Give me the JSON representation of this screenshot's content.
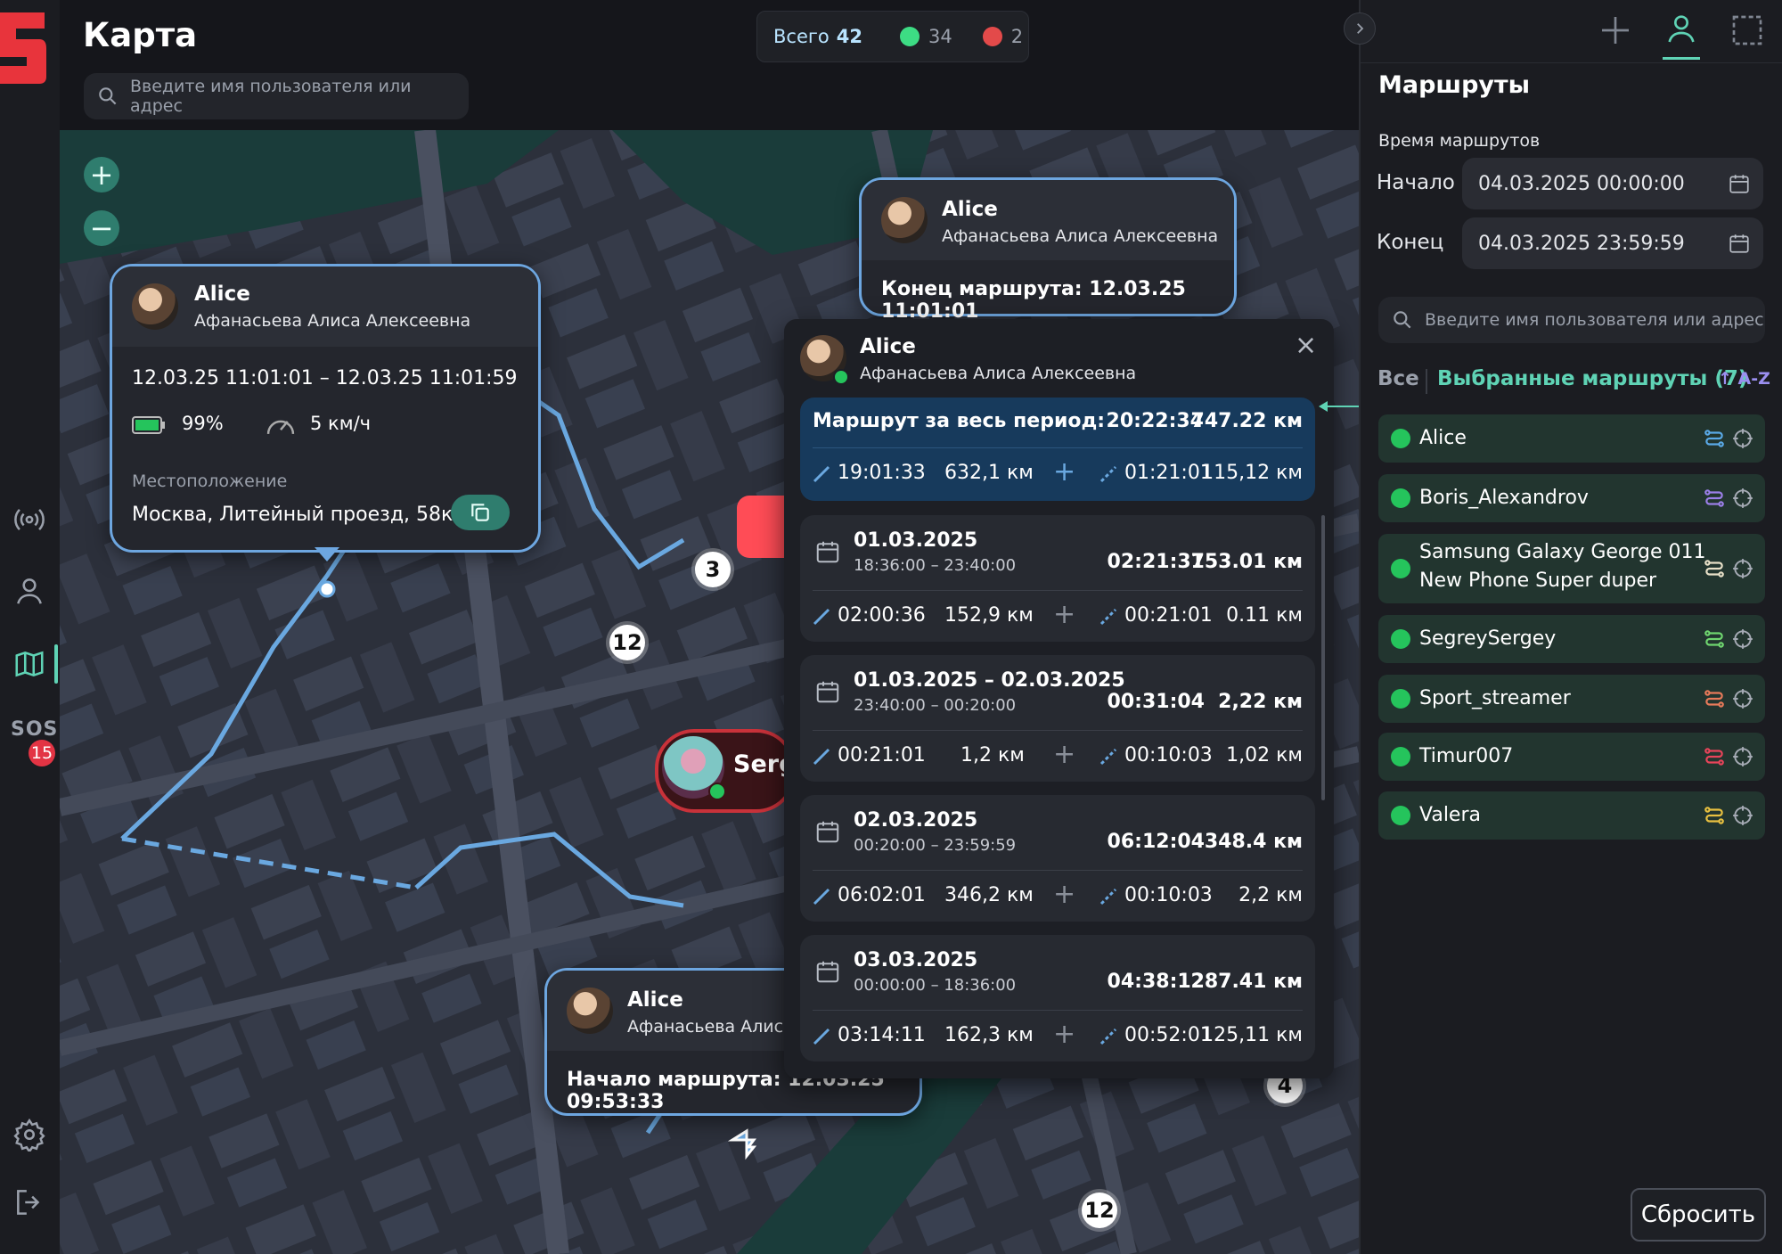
{
  "header": {
    "title": "Карта",
    "search_placeholder": "Введите имя пользователя или адрес",
    "counter": {
      "total_label": "Всего",
      "total": "42",
      "online": "34",
      "offline": "2"
    }
  },
  "sidebar": {
    "sos_label": "SOS",
    "sos_count": "15"
  },
  "map": {
    "clusters": [
      "3",
      "12",
      "4",
      "12"
    ],
    "marker_name": "Serg",
    "card_main": {
      "name": "Alice",
      "full_name": "Афанасьева Алиса Алексеевна",
      "range": "12.03.25  11:01:01 – 12.03.25  11:01:59",
      "battery": "99%",
      "speed": "5 км/ч",
      "location_label": "Местоположение",
      "address": "Москва, Литейный проезд, 58к2"
    },
    "card_end": {
      "name": "Alice",
      "full_name": "Афанасьева Алиса Алексеевна",
      "text": "Конец маршрута: 12.03.25  11:01:01"
    },
    "card_start": {
      "name": "Alice",
      "full_name": "Афанасьева Алиса",
      "text": "Начало маршрута: 12.03.25  09:53:33"
    }
  },
  "popup": {
    "name": "Alice",
    "full_name": "Афанасьева Алиса Алексеевна",
    "total": {
      "label": "Маршрут за весь период:",
      "duration": "20:22:34",
      "distance": "747.22 км",
      "move_time": "19:01:33",
      "move_dist": "632,1 км",
      "gap_time": "01:21:01",
      "gap_dist": "115,12 км"
    },
    "segments": [
      {
        "date": "01.03.2025",
        "time": "18:36:00 – 23:40:00",
        "duration": "02:21:37",
        "distance": "153.01 км",
        "move_time": "02:00:36",
        "move_dist": "152,9 км",
        "gap_time": "00:21:01",
        "gap_dist": "0.11 км"
      },
      {
        "date": "01.03.2025 – 02.03.2025",
        "time": "23:40:00 – 00:20:00",
        "duration": "00:31:04",
        "distance": "2,22 км",
        "move_time": "00:21:01",
        "move_dist": "1,2 км",
        "gap_time": "00:10:03",
        "gap_dist": "1,02 км"
      },
      {
        "date": "02.03.2025",
        "time": "00:20:00 – 23:59:59",
        "duration": "06:12:04",
        "distance": "348.4 км",
        "move_time": "06:02:01",
        "move_dist": "346,2 км",
        "gap_time": "00:10:03",
        "gap_dist": "2,2 км"
      },
      {
        "date": "03.03.2025",
        "time": "00:00:00 – 18:36:00",
        "duration": "04:38:12",
        "distance": "287.41 км",
        "move_time": "03:14:11",
        "move_dist": "162,3 км",
        "gap_time": "00:52:01",
        "gap_dist": "125,11 км"
      }
    ]
  },
  "routes_panel": {
    "title": "Маршруты",
    "time_label": "Время маршрутов",
    "start_label": "Начало",
    "start_value": "04.03.2025  00:00:00",
    "end_label": "Конец",
    "end_value": "04.03.2025  23:59:59",
    "search_placeholder": "Введите имя пользователя или адрес",
    "filter_all": "Все",
    "filter_selected": "Выбранные маршруты (7)",
    "sort": "A-Z",
    "users": [
      {
        "name": "Alice",
        "route_color": "#5aa9e6"
      },
      {
        "name": "Boris_Alexandrov",
        "route_color": "#9b7fe8"
      },
      {
        "name": "Samsung Galaxy  George 011",
        "name2": "New Phone Super duper",
        "route_color": "#e8e0c8"
      },
      {
        "name": "SegreySergey",
        "route_color": "#6fd66f"
      },
      {
        "name": "Sport_streamer",
        "route_color": "#e87a5a"
      },
      {
        "name": "Timur007",
        "route_color": "#e8445a"
      },
      {
        "name": "Valera",
        "route_color": "#e8c040"
      }
    ],
    "reset_label": "Сбросить"
  },
  "colors": {
    "accent": "#5fd3b5",
    "route": "#6aa8e0",
    "online": "#25c45c",
    "offline": "#e34a4a"
  }
}
